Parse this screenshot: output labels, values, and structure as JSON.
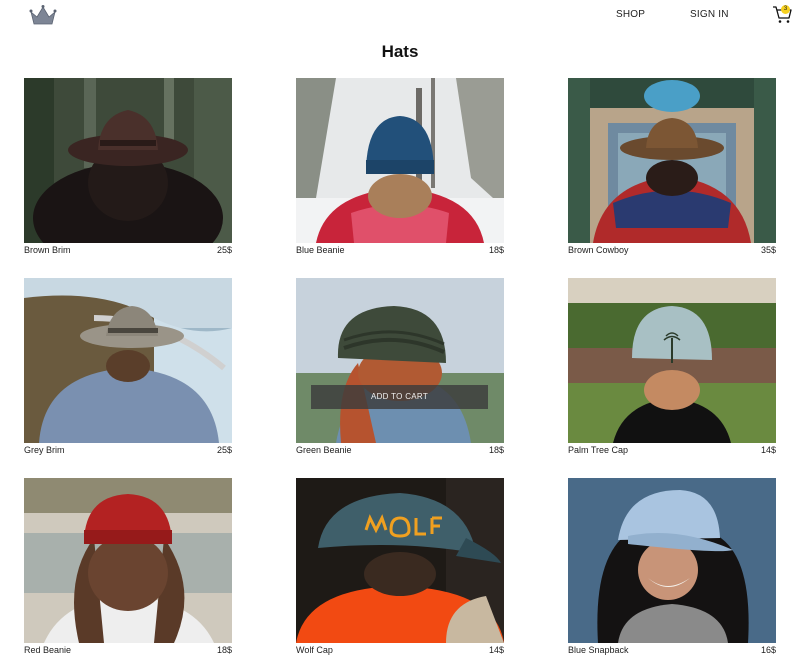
{
  "header": {
    "nav_shop": "SHOP",
    "nav_signin": "SIGN IN",
    "cart_count": "3"
  },
  "page": {
    "title": "Hats"
  },
  "products": [
    {
      "name": "Brown Brim",
      "price": "25$"
    },
    {
      "name": "Blue Beanie",
      "price": "18$"
    },
    {
      "name": "Brown Cowboy",
      "price": "35$"
    },
    {
      "name": "Grey Brim",
      "price": "25$"
    },
    {
      "name": "Green Beanie",
      "price": "18$",
      "overlay": "ADD TO CART"
    },
    {
      "name": "Palm Tree Cap",
      "price": "14$"
    },
    {
      "name": "Red Beanie",
      "price": "18$"
    },
    {
      "name": "Wolf Cap",
      "price": "14$"
    },
    {
      "name": "Blue Snapback",
      "price": "16$"
    }
  ],
  "colors": {
    "accent_badge": "#f7d11e",
    "overlay_button": "#3c3c3c"
  },
  "icons": {
    "logo": "crown-icon",
    "cart": "shopping-bag-icon"
  }
}
